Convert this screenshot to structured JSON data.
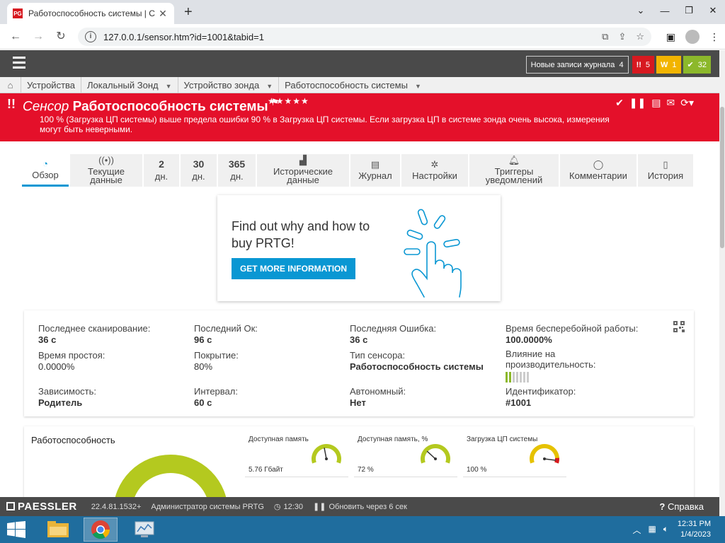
{
  "browser": {
    "tab_title": "Работоспособность системы | С",
    "url": "127.0.0.1/sensor.htm?id=1001&tabid=1"
  },
  "prtg_header": {
    "new_log_label": "Новые записи журнала",
    "new_log_count": "4",
    "badge_red": "5",
    "badge_yellow": "1",
    "badge_green": "32"
  },
  "breadcrumbs": [
    "Устройства",
    "Локальный Зонд",
    "Устройство зонда",
    "Работоспособность системы"
  ],
  "sensor": {
    "prefix": "Сенсор",
    "name": "Работоспособность системы",
    "stars": "★★★★★",
    "message": "100 % (Загрузка ЦП системы) выше предела ошибки 90 % в Загрузка ЦП системы. Если загрузка ЦП в системе зонда очень высока, измерения могут быть неверными."
  },
  "tabs": [
    {
      "label": "Обзор",
      "icon": "gauge-icon"
    },
    {
      "label": "Текущие данные",
      "icon": "live-icon"
    },
    {
      "label": "2",
      "sub": "дн."
    },
    {
      "label": "30",
      "sub": "дн."
    },
    {
      "label": "365",
      "sub": "дн."
    },
    {
      "label": "Исторические данные",
      "icon": "area-chart-icon"
    },
    {
      "label": "Журнал",
      "icon": "log-icon"
    },
    {
      "label": "Настройки",
      "icon": "gear-icon"
    },
    {
      "label": "Триггеры уведомлений",
      "icon": "bell-icon"
    },
    {
      "label": "Комментарии",
      "icon": "comment-icon"
    },
    {
      "label": "История",
      "icon": "history-icon"
    }
  ],
  "promo": {
    "text": "Find out why and how to buy PRTG!",
    "button": "GET MORE INFORMATION"
  },
  "stats": {
    "last_scan_label": "Последнее сканирование:",
    "last_scan_value": "36 с",
    "last_ok_label": "Последний Ок:",
    "last_ok_value": "96 с",
    "last_error_label": "Последняя Ошибка:",
    "last_error_value": "36 с",
    "uptime_label": "Время бесперебойной работы:",
    "uptime_value": "100.0000%",
    "downtime_label": "Время простоя:",
    "downtime_value": "0.0000%",
    "coverage_label": "Покрытие:",
    "coverage_value": "80%",
    "sensor_type_label": "Тип сенсора:",
    "sensor_type_value": "Работоспособность системы",
    "impact_label": "Влияние на производительность:",
    "impact_level": 0.2,
    "dependency_label": "Зависимость:",
    "dependency_value": "Родитель",
    "interval_label": "Интервал:",
    "interval_value": "60 с",
    "autonomous_label": "Автономный:",
    "autonomous_value": "Нет",
    "id_label": "Идентификатор:",
    "id_value": "#1001"
  },
  "health": {
    "title": "Работоспособность",
    "channels": [
      {
        "name": "Доступная память",
        "value": "5.76 Гбайт",
        "level": 0.45,
        "color": "#b4c91f"
      },
      {
        "name": "Доступная память, %",
        "value": "72 %",
        "level": 0.28,
        "color": "#b4c91f"
      },
      {
        "name": "Загрузка ЦП системы",
        "value": "100 %",
        "level": 0.95,
        "color": "#e6c200"
      }
    ]
  },
  "footer": {
    "brand": "PAESSLER",
    "version": "22.4.81.1532+",
    "user": "Администратор системы PRTG",
    "time": "12:30",
    "refresh": "Обновить через 6 сек",
    "help": "Справка"
  },
  "taskbar": {
    "clock_time": "12:31 PM",
    "clock_date": "1/4/2023"
  },
  "colors": {
    "accent": "#0a97d3",
    "alert": "#e4102a",
    "header": "#4a4a4a"
  }
}
